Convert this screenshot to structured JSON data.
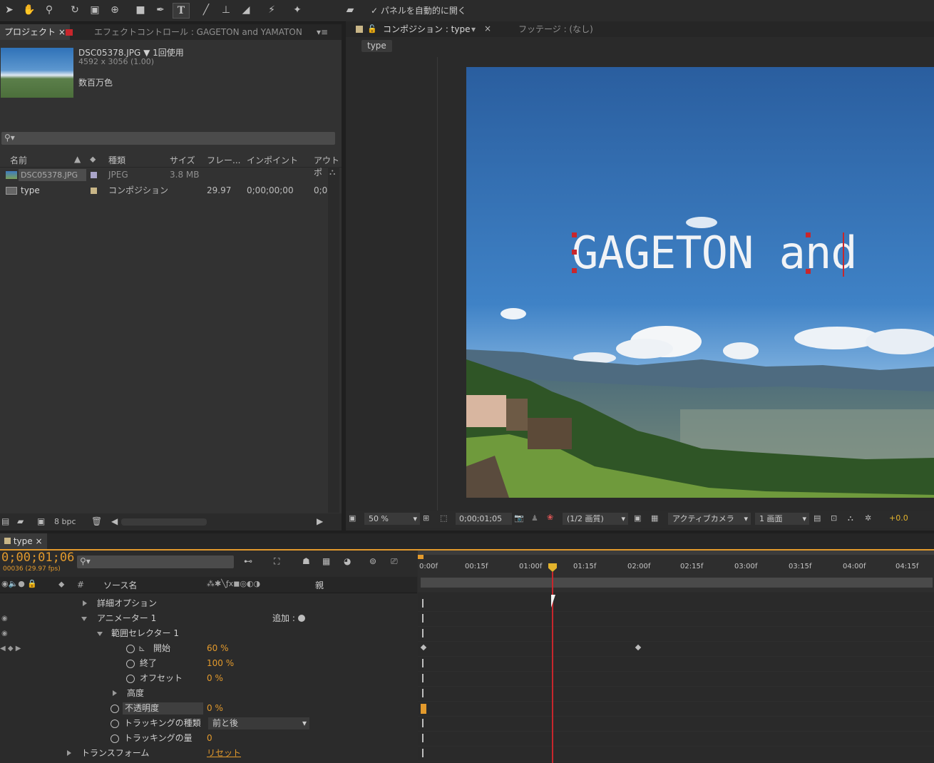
{
  "toolbar": {
    "tools": [
      "selection-tool",
      "hand-tool",
      "zoom-tool",
      "rotate-tool",
      "camera-tool",
      "pan-behind-tool",
      "rectangle-tool",
      "pen-tool",
      "text-tool",
      "brush-tool",
      "clone-stamp-tool",
      "eraser-tool",
      "roto-brush-tool",
      "puppet-tool"
    ],
    "text_tool_glyph": "T",
    "auto_open_label": "✓ パネルを自動的に開く"
  },
  "project_panel": {
    "tab_project": "プロジェクト",
    "tab_effects": "エフェクトコントロール : GAGETON and YAMATON",
    "file_name": "DSC05378.JPG ▼",
    "usage": "1回使用",
    "dimensions": "4592 x 3056 (1.00)",
    "colors": "数百万色",
    "columns": [
      "名前",
      "種類",
      "サイズ",
      "フレー...",
      "インポイント",
      "アウトポ"
    ],
    "items": [
      {
        "name": "DSC05378.JPG",
        "type": "JPEG",
        "size": "3.8 MB",
        "frame": "",
        "inpoint": "",
        "out": ""
      },
      {
        "name": "type",
        "type": "コンポジション",
        "size": "",
        "frame": "29.97",
        "inpoint": "0;00;00;00",
        "out": "0;0"
      }
    ],
    "bpc_label": "8 bpc"
  },
  "comp_panel": {
    "tab_comp": "コンポジション : type",
    "tab_footage": "フッテージ : (なし)",
    "comp_button": "type",
    "overlay_text": "GAGETON and",
    "footer": {
      "zoom": "50 %",
      "timecode": "0;00;01;05",
      "resolution": "(1/2 画質)",
      "camera": "アクティブカメラ",
      "views": "1 画面",
      "exposure": "+0.0"
    }
  },
  "timeline": {
    "tab": "type",
    "timecode": "0;00;01;06",
    "frame_info": "00036 (29.97 fps)",
    "header": {
      "hash": "#",
      "source": "ソース名",
      "parent": "親"
    },
    "ruler": [
      "0:00f",
      "00:15f",
      "01:00f",
      "01:15f",
      "02:00f",
      "02:15f",
      "03:00f",
      "03:15f",
      "04:00f",
      "04:15f"
    ],
    "rows": [
      {
        "label": "詳細オプション",
        "value": ""
      },
      {
        "label": "アニメーター 1",
        "value": "追加 :"
      },
      {
        "label": "範囲セレクター 1",
        "value": ""
      },
      {
        "label": "開始",
        "value": "60 %"
      },
      {
        "label": "終了",
        "value": "100 %"
      },
      {
        "label": "オフセット",
        "value": "0 %"
      },
      {
        "label": "高度",
        "value": ""
      },
      {
        "label": "不透明度",
        "value": "0 %"
      },
      {
        "label": "トラッキングの種類",
        "value": "前と後"
      },
      {
        "label": "トラッキングの量",
        "value": "0"
      },
      {
        "label": "トランスフォーム",
        "value": "リセット"
      }
    ]
  },
  "colors": {
    "accent_orange": "#e39a2c",
    "playhead_red": "#c8262c",
    "panel_bg": "#323232",
    "sky_blue": "#2d6fb5"
  }
}
